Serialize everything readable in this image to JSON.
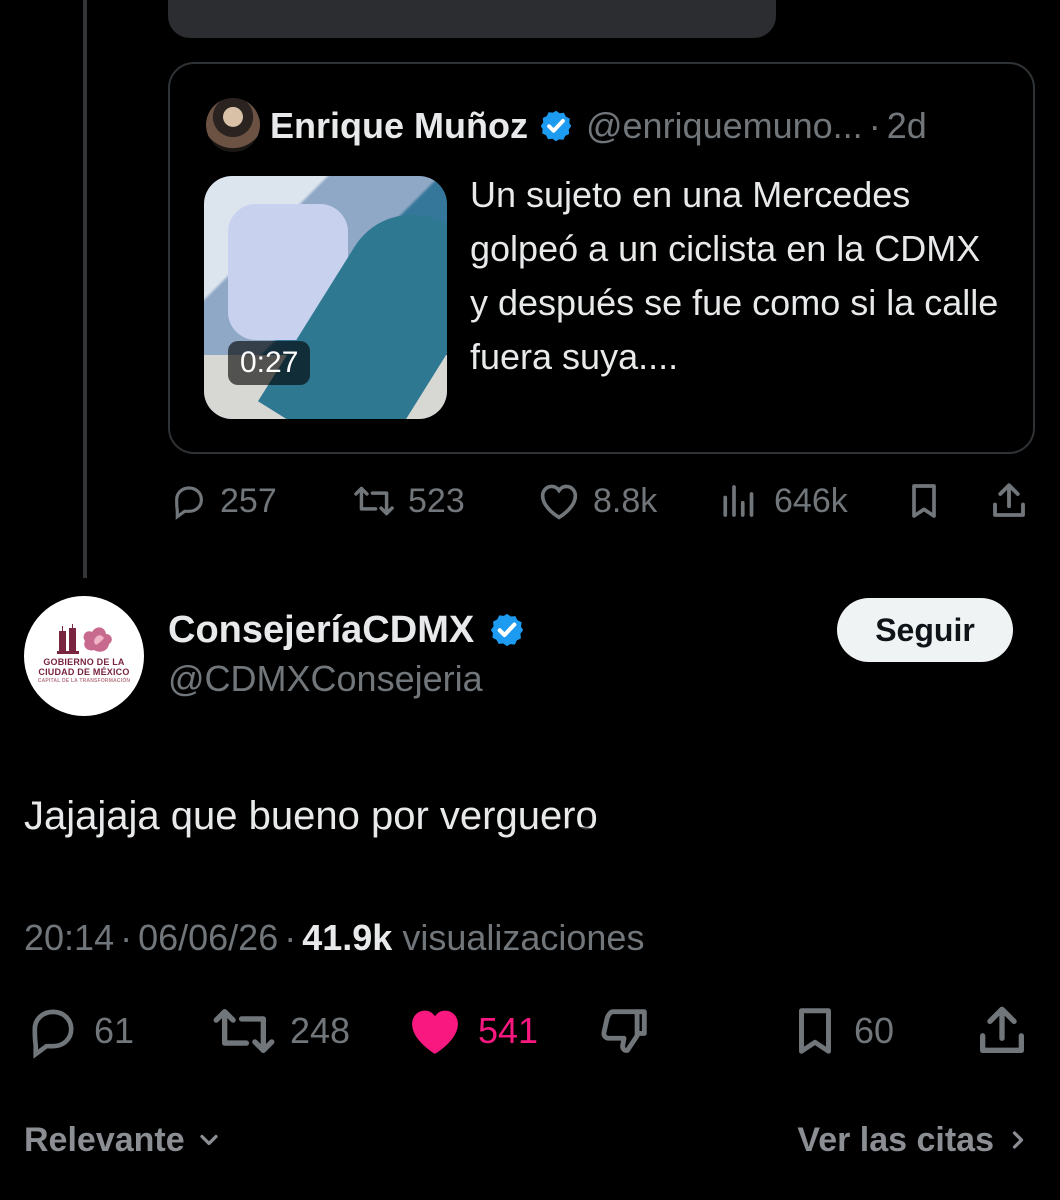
{
  "quoted_post": {
    "author_name": "Enrique Muñoz",
    "handle": "@enriquemuno...",
    "separator": "·",
    "age": "2d",
    "video_duration": "0:27",
    "text": "Un sujeto en una Mercedes golpeó a un ciclista en la CDMX y después se fue como si la calle fuera suya...."
  },
  "quoted_actions": {
    "replies": "257",
    "reposts": "523",
    "likes": "8.8k",
    "views": "646k"
  },
  "post": {
    "author_name": "ConsejeríaCDMX",
    "handle": "@CDMXConsejeria",
    "follow_label": "Seguir",
    "text": "Jajajaja que bueno por verguero",
    "time": "20:14",
    "date": "06/06/26",
    "dot": "·",
    "views_count": "41.9k",
    "views_label": "visualizaciones",
    "avatar_logo_line1": "GOBIERNO DE LA",
    "avatar_logo_line2": "CIUDAD DE MÉXICO",
    "avatar_logo_line3": "CAPITAL DE LA TRANSFORMACIÓN"
  },
  "post_actions": {
    "replies": "61",
    "reposts": "248",
    "likes": "541",
    "bookmarks": "60"
  },
  "footer": {
    "sort_label": "Relevante",
    "quotes_link": "Ver las citas"
  },
  "colors": {
    "background": "#000000",
    "primary_text": "#e7e9ea",
    "secondary_text": "#71767b",
    "verified_blue": "#1d9bf0",
    "like_pink": "#f91880",
    "button_bg": "#eff3f4"
  },
  "icons": {
    "verified": "verified-icon",
    "reply": "reply-icon",
    "repost": "repost-icon",
    "like": "heart-icon",
    "views": "views-icon",
    "bookmark": "bookmark-icon",
    "share": "share-icon",
    "dislike": "dislike-icon",
    "chevron_down": "chevron-down-icon",
    "chevron_right": "chevron-right-icon"
  }
}
